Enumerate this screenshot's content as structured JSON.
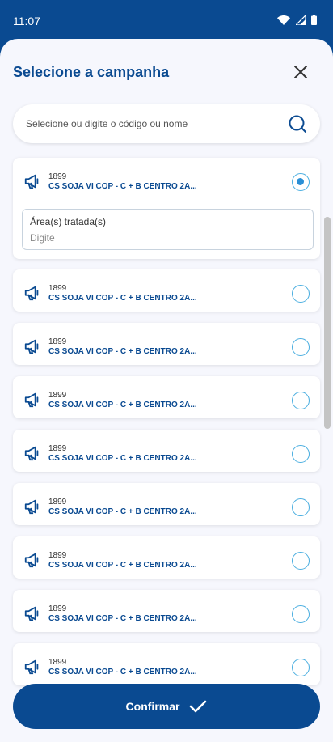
{
  "status_bar": {
    "time": "11:07"
  },
  "sheet": {
    "title": "Selecione a campanha",
    "search_placeholder": "Selecione ou digite o código ou nome"
  },
  "campaigns": [
    {
      "code": "1899",
      "name": "CS SOJA VI COP - C + B CENTRO 2A...",
      "selected": true
    },
    {
      "code": "1899",
      "name": "CS SOJA VI COP - C + B CENTRO 2A...",
      "selected": false
    },
    {
      "code": "1899",
      "name": "CS SOJA VI COP - C + B CENTRO 2A...",
      "selected": false
    },
    {
      "code": "1899",
      "name": "CS SOJA VI COP - C + B CENTRO 2A...",
      "selected": false
    },
    {
      "code": "1899",
      "name": "CS SOJA VI COP - C + B CENTRO 2A...",
      "selected": false
    },
    {
      "code": "1899",
      "name": "CS SOJA VI COP - C + B CENTRO 2A...",
      "selected": false
    },
    {
      "code": "1899",
      "name": "CS SOJA VI COP - C + B CENTRO 2A...",
      "selected": false
    },
    {
      "code": "1899",
      "name": "CS SOJA VI COP - C + B CENTRO 2A...",
      "selected": false
    },
    {
      "code": "1899",
      "name": "CS SOJA VI COP - C + B CENTRO 2A...",
      "selected": false
    }
  ],
  "area_field": {
    "label": "Área(s) tratada(s)",
    "placeholder": "Digite"
  },
  "confirm_label": "Confirmar",
  "colors": {
    "primary": "#0a4a91",
    "radio": "#4aaee0",
    "background": "#f6f7fd"
  }
}
